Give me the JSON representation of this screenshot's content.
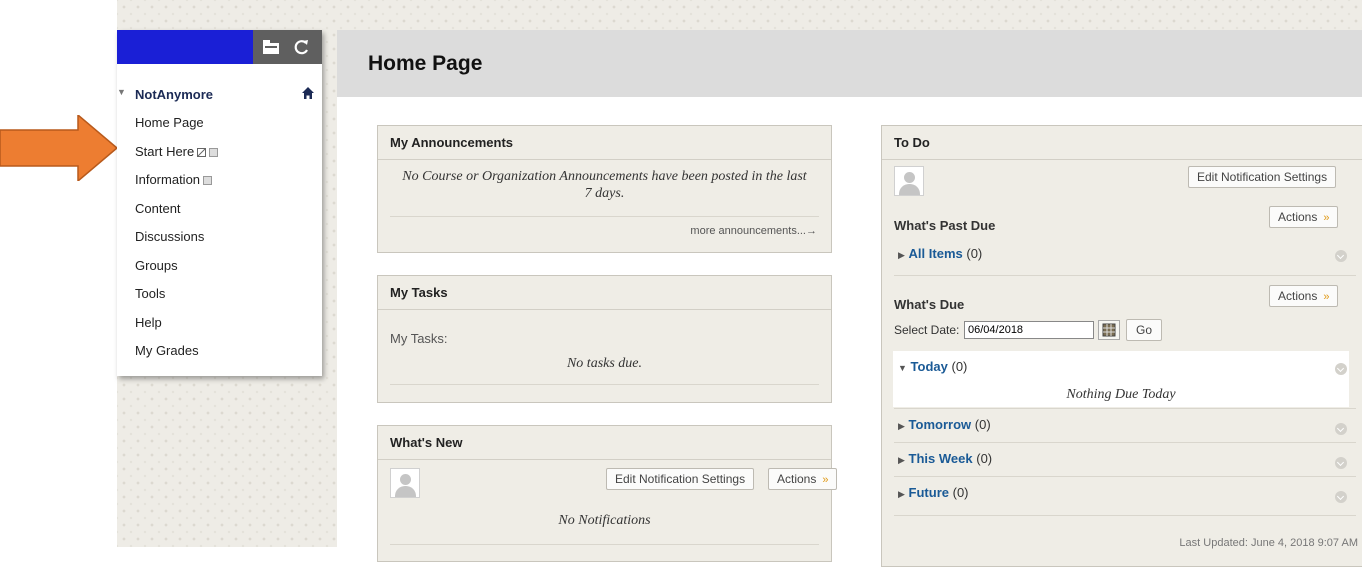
{
  "course_menu": {
    "course_title": "NotAnymore",
    "items": [
      {
        "label": "Home Page"
      },
      {
        "label": "Start Here"
      },
      {
        "label": "Information"
      },
      {
        "label": "Content"
      },
      {
        "label": "Discussions"
      },
      {
        "label": "Groups"
      },
      {
        "label": "Tools"
      },
      {
        "label": "Help"
      },
      {
        "label": "My Grades"
      }
    ]
  },
  "page": {
    "title": "Home Page"
  },
  "announcements": {
    "title": "My Announcements",
    "empty_text": "No Course or Organization Announcements have been posted in the last 7 days.",
    "more_link": "more announcements...→"
  },
  "tasks": {
    "title": "My Tasks",
    "label": "My Tasks:",
    "empty_text": "No tasks due."
  },
  "whats_new": {
    "title": "What's New",
    "edit_button": "Edit Notification Settings",
    "actions_button": "Actions",
    "empty_text": "No Notifications"
  },
  "todo": {
    "title": "To Do",
    "edit_button": "Edit Notification Settings",
    "past_due": {
      "heading": "What's Past Due",
      "actions_button": "Actions",
      "items": [
        {
          "label": "All Items",
          "count": "(0)"
        }
      ]
    },
    "due": {
      "heading": "What's Due",
      "actions_button": "Actions",
      "select_date_label": "Select Date:",
      "date_value": "06/04/2018",
      "go_button": "Go",
      "today": {
        "label": "Today",
        "count": "(0)",
        "empty_text": "Nothing Due Today"
      },
      "items": [
        {
          "label": "Tomorrow",
          "count": "(0)"
        },
        {
          "label": "This Week",
          "count": "(0)"
        },
        {
          "label": "Future",
          "count": "(0)"
        }
      ]
    },
    "last_updated": "Last Updated: June 4, 2018 9:07 AM"
  },
  "colors": {
    "menu_blue": "#1a1fd6",
    "link_blue": "#1a5a96",
    "callout_arrow": "#ed7d31",
    "accent_chevron": "#e09a18"
  }
}
